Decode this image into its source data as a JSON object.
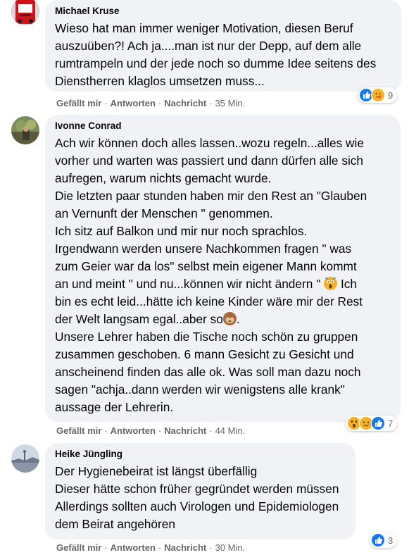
{
  "comments": [
    {
      "author": "Michael Kruse",
      "paragraphs": [
        "Wieso hat man immer weniger Motivation, diesen Beruf auszuüben?! Ach ja....man ist nur der Depp, auf dem alle rumtrampeln und der jede noch so dumme Idee seitens des Dienstherren klaglos umsetzen muss..."
      ],
      "actions": {
        "like": "Gefällt mir",
        "reply": "Antworten",
        "message": "Nachricht",
        "time": "35 Min."
      },
      "reactions": {
        "icons": [
          "like-icon",
          "care-icon"
        ],
        "count": "9"
      }
    },
    {
      "author": "Ivonne Conrad",
      "line1": "Ach wir können doch alles lassen..wozu regeln...alles wie",
      "line2": "vorher und warten was passiert und dann dürfen alle sich",
      "line3": "aufregen, warum nichts gemacht wurde.",
      "line4": "Die letzten paar stunden haben mir den Rest an \"Glauben",
      "line5": "an Vernunft der Menschen \" genommen.",
      "line6": "Ich sitz auf Balkon und mir nur noch sprachlos.",
      "line7": "Irgendwann werden unsere Nachkommen fragen \" was",
      "line8": "zum Geier war da los\" selbst mein eigener Mann kommt",
      "line9a": "an und meint \" und nu...können wir nicht ändern \" ",
      "line9b": " Ich",
      "line10": "bin es echt leid...hätte ich keine Kinder wäre mir der Rest",
      "line11a": "der Welt langsam egal..aber so",
      "line11b": ".",
      "line12": "Unsere Lehrer haben die Tische noch schön zu gruppen",
      "line13": "zusammen geschoben. 6 mann Gesicht zu Gesicht und",
      "line14": "anscheinend finden das alle ok. Was soll man dazu noch",
      "line15": "sagen \"achja..dann werden wir wenigstens alle krank\"",
      "line16": "aussage der Lehrerin.",
      "actions": {
        "like": "Gefällt mir",
        "reply": "Antworten",
        "message": "Nachricht",
        "time": "44 Min."
      },
      "reactions": {
        "icons": [
          "wow-icon",
          "sad-icon",
          "like-icon"
        ],
        "count": "7"
      }
    },
    {
      "author": "Heike Jüngling",
      "line1": "Der Hygienebeirat ist längst überfällig",
      "line2": "Dieser hätte schon früher gegründet werden müssen",
      "line3": "Allerdings sollten auch Virologen und Epidemiologen",
      "line4": "dem Beirat angehören",
      "actions": {
        "like": "Gefällt mir",
        "reply": "Antworten",
        "message": "Nachricht",
        "time": "30 Min."
      },
      "reactions": {
        "icons": [
          "like-icon"
        ],
        "count": "3"
      }
    }
  ],
  "emoji": [
    "screaming-emoji",
    "see-no-evil-monkey-emoji"
  ],
  "colors": {
    "bubble": "#f0f2f5",
    "meta": "#65676b",
    "like": "#1877f2",
    "emoji": "#f7b125"
  }
}
